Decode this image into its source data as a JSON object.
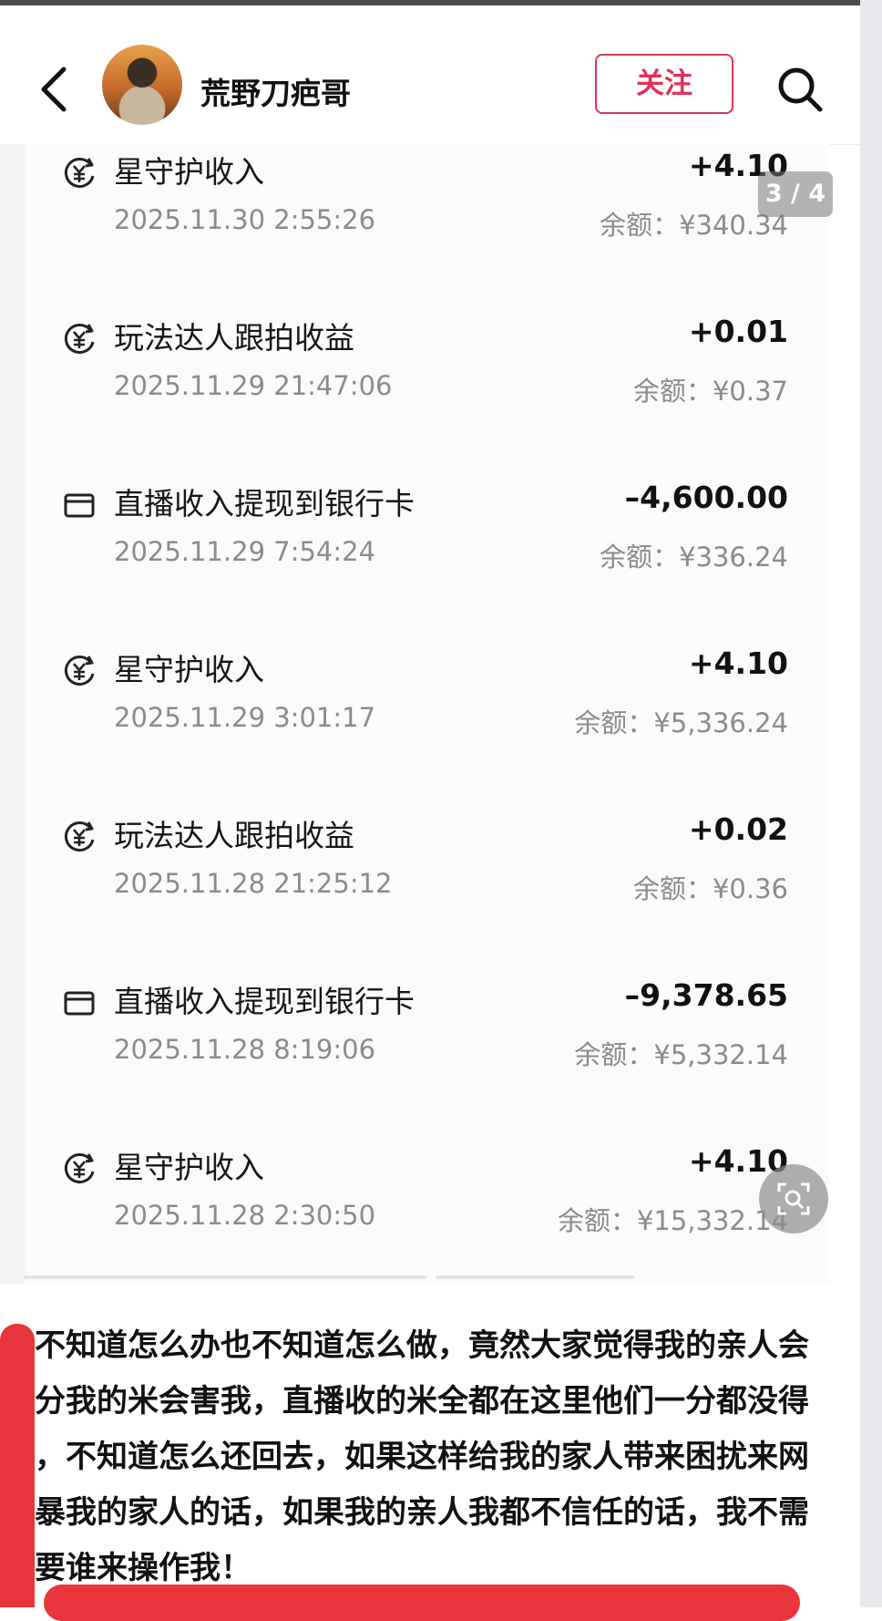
{
  "header": {
    "username": "荒野刀疤哥",
    "follow_label": "关注"
  },
  "page_indicator": "3 / 4",
  "records": [
    {
      "icon": "yuan-income-icon",
      "title": "星守护收入",
      "amount": "+4.10",
      "time": "2025.11.30 2:55:26",
      "balance": "余额：¥340.34"
    },
    {
      "icon": "yuan-income-icon",
      "title": "玩法达人跟拍收益",
      "amount": "+0.01",
      "time": "2025.11.29 21:47:06",
      "balance": "余额：¥0.37"
    },
    {
      "icon": "wallet-icon",
      "title": "直播收入提现到银行卡",
      "amount": "–4,600.00",
      "time": "2025.11.29 7:54:24",
      "balance": "余额：¥336.24"
    },
    {
      "icon": "yuan-income-icon",
      "title": "星守护收入",
      "amount": "+4.10",
      "time": "2025.11.29 3:01:17",
      "balance": "余额：¥5,336.24"
    },
    {
      "icon": "yuan-income-icon",
      "title": "玩法达人跟拍收益",
      "amount": "+0.02",
      "time": "2025.11.28 21:25:12",
      "balance": "余额：¥0.36"
    },
    {
      "icon": "wallet-icon",
      "title": "直播收入提现到银行卡",
      "amount": "–9,378.65",
      "time": "2025.11.28 8:19:06",
      "balance": "余额：¥5,332.14"
    },
    {
      "icon": "yuan-income-icon",
      "title": "星守护收入",
      "amount": "+4.10",
      "time": "2025.11.28 2:30:50",
      "balance": "余额：¥15,332.14"
    }
  ],
  "caption": "不知道怎么办也不知道怎么做，竟然大家觉得我的亲人会分我的米会害我，直播收的米全都在这里他们一分都没得 ，不知道怎么还回去，如果这样给我的家人带来困扰来网暴我的家人的话，如果我的亲人我都不信任的话，我不需要谁来操作我！",
  "colors": {
    "follow": "#e03357",
    "markup": "#e8343b"
  }
}
